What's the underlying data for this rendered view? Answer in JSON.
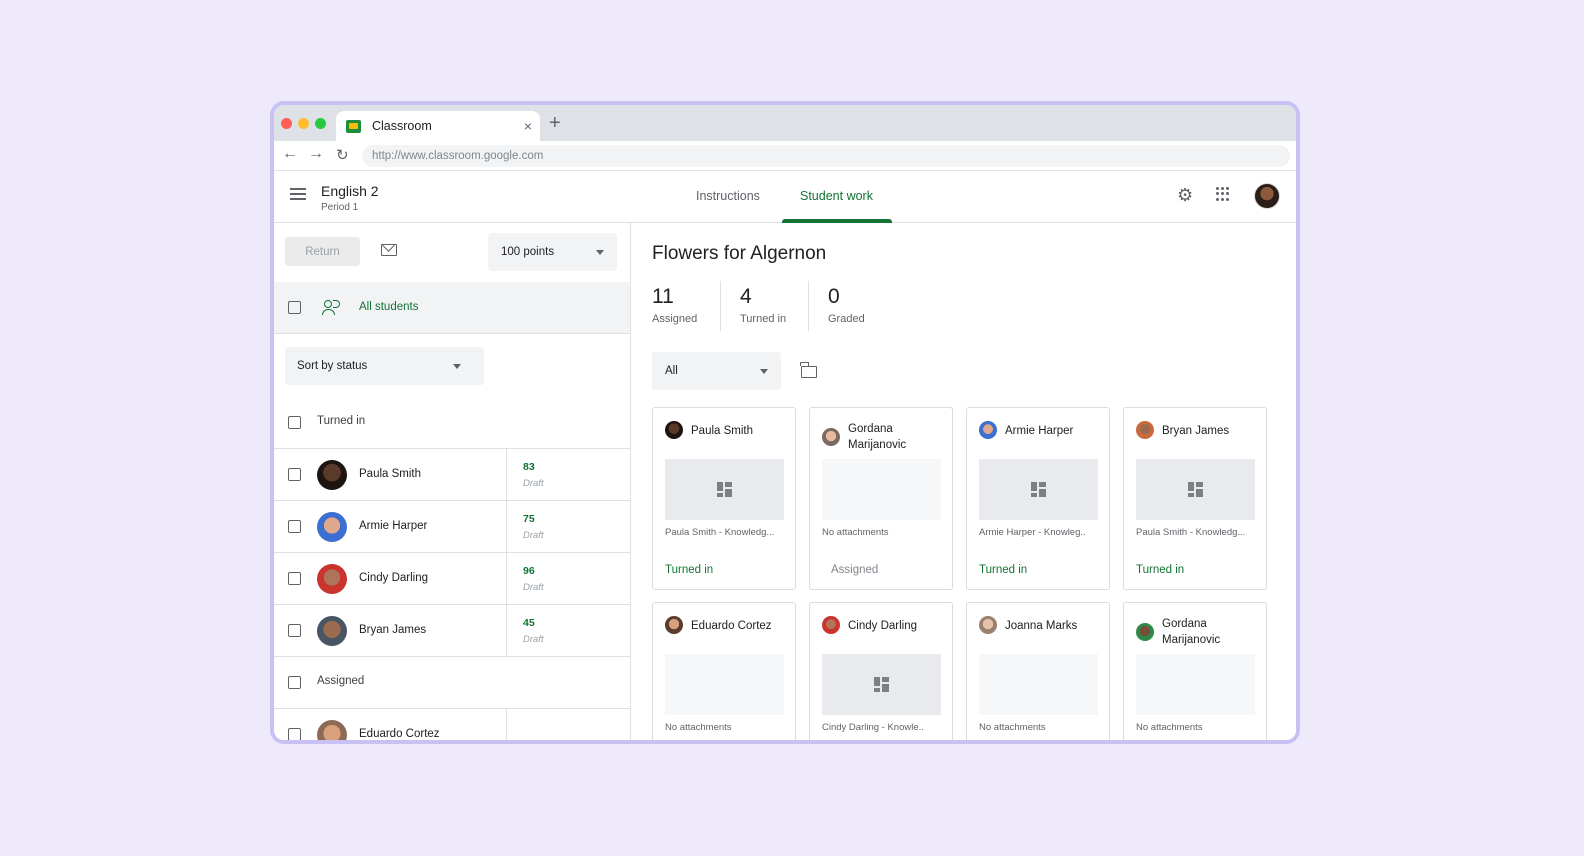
{
  "browser": {
    "tab_title": "Classroom",
    "tab_close": "×",
    "new_tab": "+",
    "url": "http://www.classroom.google.com",
    "nav": {
      "back": "←",
      "forward": "→",
      "reload": "↻"
    }
  },
  "header": {
    "class_name": "English 2",
    "class_period": "Period 1",
    "tabs": [
      {
        "label": "Instructions",
        "active": false
      },
      {
        "label": "Student work",
        "active": true
      }
    ],
    "gear_glyph": "⚙"
  },
  "left_panel": {
    "return_label": "Return",
    "points_label": "100 points",
    "all_students_label": "All students",
    "sort_label": "Sort by status",
    "groups": {
      "turned_in": "Turned in",
      "assigned": "Assigned"
    },
    "students": [
      {
        "name": "Paula Smith",
        "grade": "83",
        "status": "Draft"
      },
      {
        "name": "Armie Harper",
        "grade": "75",
        "status": "Draft"
      },
      {
        "name": "Cindy Darling",
        "grade": "96",
        "status": "Draft"
      },
      {
        "name": "Bryan James",
        "grade": "45",
        "status": "Draft"
      }
    ],
    "assigned_students": [
      {
        "name": "Eduardo Cortez"
      }
    ]
  },
  "main": {
    "assignment_title": "Flowers for Algernon",
    "stats": [
      {
        "value": "11",
        "label": "Assigned"
      },
      {
        "value": "4",
        "label": "Turned in"
      },
      {
        "value": "0",
        "label": "Graded"
      }
    ],
    "filter_label": "All",
    "cards": [
      {
        "name": "Paula Smith",
        "attachment": "Paula Smith  - Knowledg...",
        "status": "Turned in"
      },
      {
        "name": "Gordana Marijanovic",
        "attachment": "No attachments",
        "status": "Assigned"
      },
      {
        "name": "Armie Harper",
        "attachment": "Armie Harper - Knowleg..",
        "status": "Turned in"
      },
      {
        "name": "Bryan James",
        "attachment": "Paula Smith - Knowledg...",
        "status": "Turned in"
      },
      {
        "name": "Eduardo Cortez",
        "attachment": "No attachments",
        "status": ""
      },
      {
        "name": "Cindy Darling",
        "attachment": "Cindy Darling - Knowle..",
        "status": ""
      },
      {
        "name": "Joanna Marks",
        "attachment": "No attachments",
        "status": ""
      },
      {
        "name": "Gordana Marijanovic",
        "attachment": "No attachments",
        "status": ""
      }
    ]
  },
  "colors": {
    "accent_green": "#137333",
    "page_background": "#eeeafc",
    "frame_border": "#c9c1f4"
  },
  "icons": [
    "menu-icon",
    "gear-icon",
    "apps-grid-icon",
    "mail-icon",
    "people-icon",
    "folder-icon",
    "document-preview-icon",
    "chevron-down-icon"
  ]
}
